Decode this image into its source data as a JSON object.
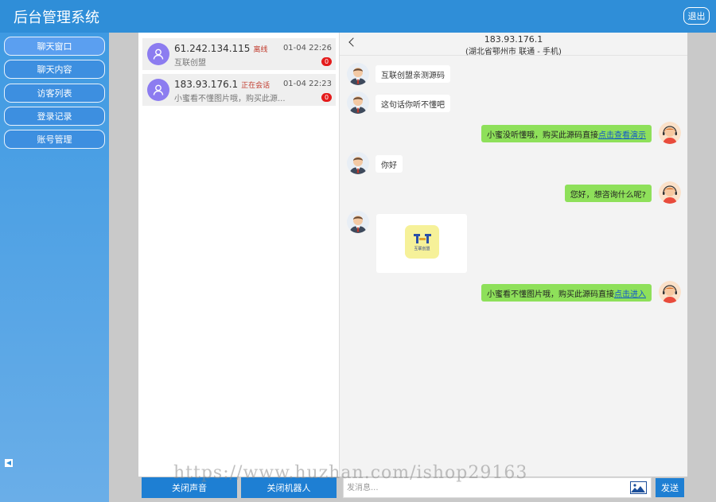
{
  "app": {
    "title": "后台管理系统",
    "logout_label": "退出"
  },
  "sidebar": {
    "items": [
      {
        "label": "聊天窗口"
      },
      {
        "label": "聊天内容"
      },
      {
        "label": "访客列表"
      },
      {
        "label": "登录记录"
      },
      {
        "label": "账号管理"
      }
    ]
  },
  "conversations": [
    {
      "ip": "61.242.134.115",
      "state": "离线",
      "time": "01-04 22:26",
      "preview": "互联创盟",
      "unread": "0"
    },
    {
      "ip": "183.93.176.1",
      "state": "正在会话",
      "time": "01-04 22:23",
      "preview": "小蜜看不懂图片哦，购买此源...",
      "unread": "0"
    }
  ],
  "list_actions": {
    "sound_label": "关闭声音",
    "robot_label": "关闭机器人"
  },
  "chat": {
    "header_ip": "183.93.176.1",
    "header_location": "(湖北省鄂州市 联通 - 手机)",
    "messages": [
      {
        "dir": "in",
        "text": "互联创盟亲测源码"
      },
      {
        "dir": "in",
        "text": "这句话你听不懂吧"
      },
      {
        "dir": "out",
        "text": "小蜜没听懂哦，购买此源码直接",
        "link": "点击查看演示"
      },
      {
        "dir": "in",
        "text": "你好"
      },
      {
        "dir": "out",
        "text": "您好，想咨询什么呢?"
      },
      {
        "dir": "in",
        "image_caption": "互联创盟"
      },
      {
        "dir": "out",
        "text": "小蜜看不懂图片哦，购买此源码直接",
        "link": "点击进入"
      }
    ],
    "input_placeholder": "发消息...",
    "send_label": "发送"
  },
  "watermark": "https://www.huzhan.com/ishop29163",
  "colors": {
    "topbar": "#2f8ed8",
    "sidebar": "#3f9ae2",
    "primary_button": "#1e7fd3",
    "bubble_out": "#8ee05a",
    "badge": "#e41b1b"
  },
  "icons": {
    "user_avatar": "person-icon",
    "visitor_avatar": "businessman-avatar",
    "agent_avatar": "support-agent-avatar",
    "image_button": "image-icon",
    "back": "chevron-left-icon"
  }
}
